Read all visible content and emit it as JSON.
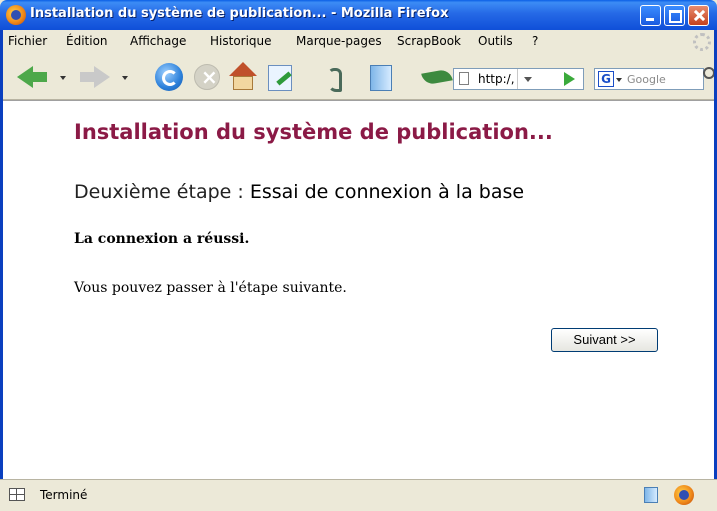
{
  "window": {
    "title": "Installation du système de publication... - Mozilla Firefox"
  },
  "menu": {
    "items": [
      {
        "label": "Fichier"
      },
      {
        "label": "Édition"
      },
      {
        "label": "Affichage"
      },
      {
        "label": "Historique"
      },
      {
        "label": "Marque-pages"
      },
      {
        "label": "ScrapBook"
      },
      {
        "label": "Outils"
      },
      {
        "label": "?"
      }
    ]
  },
  "toolbar": {
    "url_text": "http:/,",
    "search_placeholder": "Google",
    "search_engine_letter": "G"
  },
  "page": {
    "title": "Installation du système de publication...",
    "step_label": "Deuxième étape : ",
    "step_title": "Essai de connexion à la base",
    "success_message": "La connexion a réussi.",
    "next_message": "Vous pouvez passer à l'étape suivante.",
    "next_button": "Suivant >>"
  },
  "status": {
    "text": "Terminé"
  },
  "colors": {
    "title_bar": "#2569E6",
    "page_title": "#8B1A46",
    "chrome": "#ECE9D8"
  }
}
